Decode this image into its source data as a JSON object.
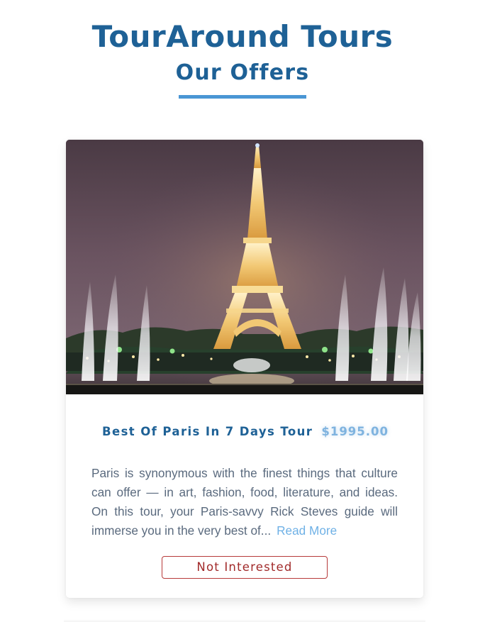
{
  "header": {
    "site_title": "TourAround Tours",
    "section_title": "Our Offers"
  },
  "tour": {
    "name": "Best Of Paris In 7 Days Tour",
    "price": "$1995.00",
    "description": "Paris is synonymous with the finest things that culture can offer — in art, fashion, food, literature, and ideas. On this tour, your Paris-savvy Rick Steves guide will immerse you in the very best of...",
    "read_more_label": "Read More",
    "not_interested_label": "Not Interested"
  },
  "colors": {
    "title_blue": "#1e6196",
    "accent_blue": "#4a96d4",
    "price_blue": "#7fb3df",
    "link_blue": "#6fb1e6",
    "button_red": "#b73a3a"
  }
}
